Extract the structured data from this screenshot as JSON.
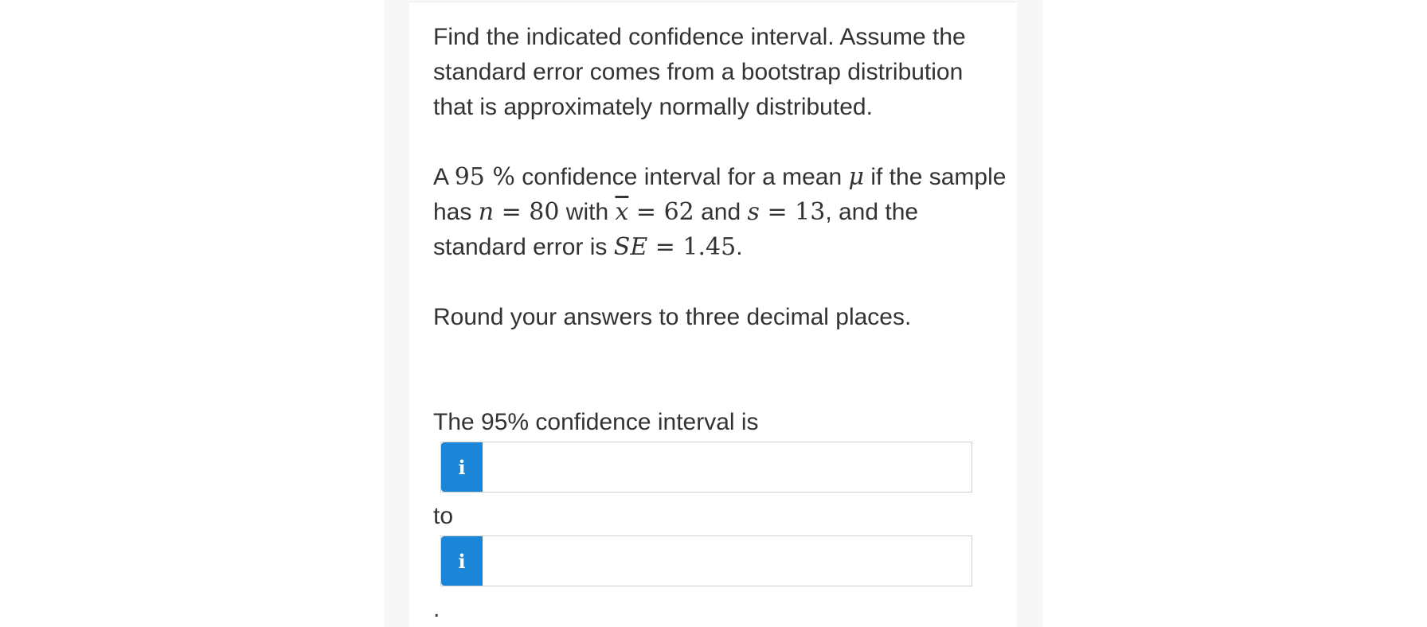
{
  "question": {
    "instructions": "Find the indicated confidence interval. Assume the standard error comes from a bootstrap distribution that is approximately normally distributed.",
    "problem": {
      "p1": "A",
      "level": "95 %",
      "p2": " confidence interval for a mean ",
      "mu": "μ",
      "p3": " if the sample has ",
      "n_sym": "n",
      "n_val": " = 80",
      "p4": " with ",
      "xbar_sym": "x",
      "xbar_val": " = 62",
      "p5": " and ",
      "s_sym": "s",
      "s_val": " = 13",
      "p6": ", and the standard error is ",
      "se_sym": "SE",
      "se_val": " = 1.45",
      "p7": "."
    },
    "rounding": "Round your answers to three decimal places.",
    "interval_label": "The 95% confidence interval is",
    "to_label": "to",
    "trailing_period": "."
  },
  "answers": {
    "lower": {
      "info_icon": "i",
      "value": ""
    },
    "upper": {
      "info_icon": "i",
      "value": ""
    }
  },
  "colors": {
    "info_button": "#1b86d8",
    "text": "#333333",
    "input_border": "#cfcfcf",
    "page_band": "#f7f7f7"
  }
}
